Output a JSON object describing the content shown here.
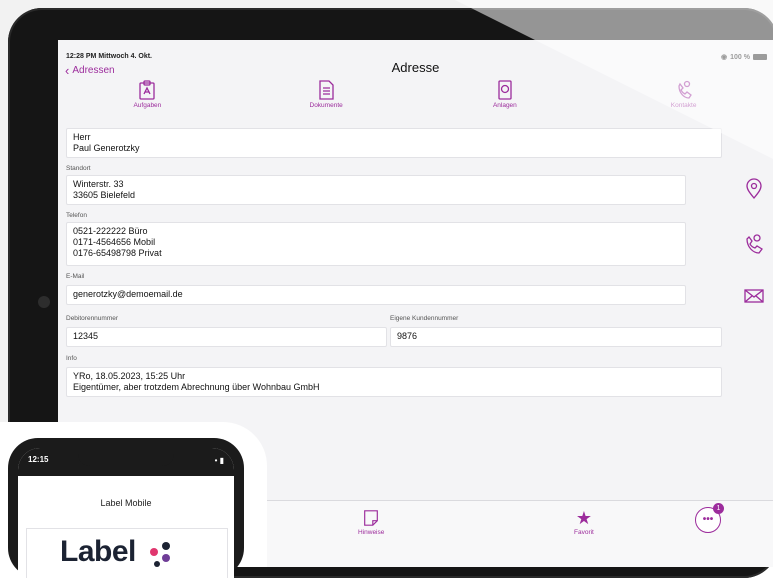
{
  "status": {
    "time": "12:28 PM",
    "date": "Mittwoch 4. Okt.",
    "battery": "100 %"
  },
  "nav": {
    "back_label": "Adressen",
    "title": "Adresse"
  },
  "toolbar": [
    {
      "label": "Aufgaben",
      "icon": "clipboard-icon"
    },
    {
      "label": "Dokumente",
      "icon": "document-icon"
    },
    {
      "label": "Anlagen",
      "icon": "device-icon"
    },
    {
      "label": "Kontakte",
      "icon": "phone-icon"
    }
  ],
  "address": {
    "name_line1": "Herr",
    "name_line2": "Paul Generotzky",
    "standort_label": "Standort",
    "standort_line1": "Winterstr. 33",
    "standort_line2": "33605 Bielefeld",
    "telefon_label": "Telefon",
    "telefon_line1": "0521-222222 Büro",
    "telefon_line2": "0171-4564656 Mobil",
    "telefon_line3": "0176-65498798 Privat",
    "email_label": "E-Mail",
    "email": "generotzky@demoemail.de",
    "debitor_label": "Debitorennummer",
    "debitor": "12345",
    "kunden_label": "Eigene Kundennummer",
    "kunden": "9876",
    "info_label": "Info",
    "info_line1": "YRo, 18.05.2023, 15:25 Uhr",
    "info_line2": "Eigentümer, aber trotzdem Abrechnung über Wohnbau GmbH"
  },
  "tabbar": {
    "hinweise": "Hinweise",
    "favorit": "Favorit",
    "more_badge": "1"
  },
  "phone": {
    "time": "12:15",
    "header": "Label Mobile",
    "logo": "Label"
  },
  "colors": {
    "accent": "#9c2c9c"
  }
}
